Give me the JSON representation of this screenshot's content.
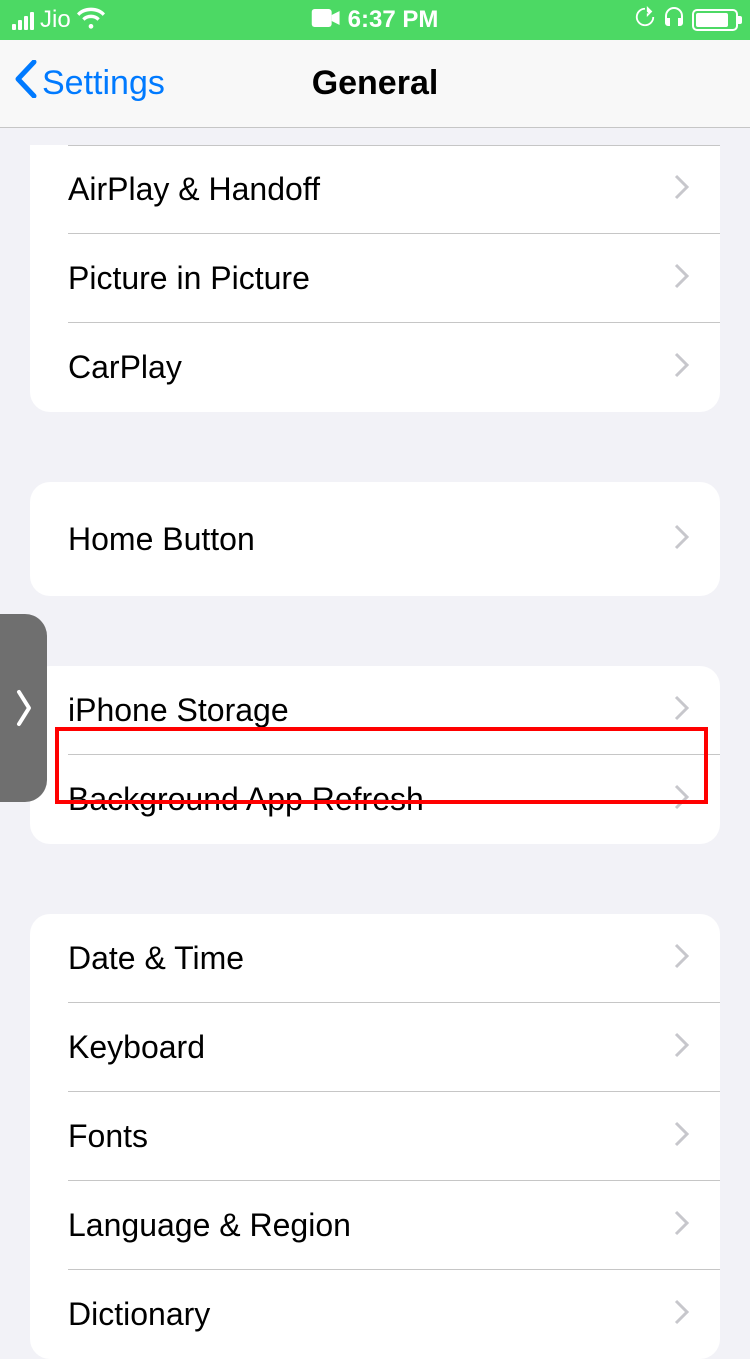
{
  "status": {
    "carrier": "Jio",
    "time": "6:37 PM"
  },
  "nav": {
    "back": "Settings",
    "title": "General"
  },
  "group1": {
    "airplay": "AirPlay & Handoff",
    "pip": "Picture in Picture",
    "carplay": "CarPlay"
  },
  "group2": {
    "home": "Home Button"
  },
  "group3": {
    "storage": "iPhone Storage",
    "refresh": "Background App Refresh"
  },
  "group4": {
    "datetime": "Date & Time",
    "keyboard": "Keyboard",
    "fonts": "Fonts",
    "language": "Language & Region",
    "dictionary": "Dictionary"
  }
}
